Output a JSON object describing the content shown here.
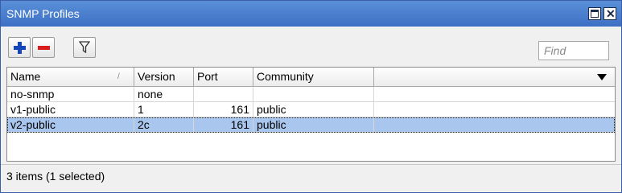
{
  "window": {
    "title": "SNMP Profiles",
    "maximize_icon": "maximize-icon",
    "close_icon": "close-icon",
    "close_glyph": "✕"
  },
  "toolbar": {
    "add_icon": "plus-icon",
    "remove_icon": "minus-icon",
    "filter_icon": "filter-icon",
    "find_placeholder": "Find"
  },
  "table": {
    "columns": [
      "Name",
      "Version",
      "Port",
      "Community"
    ],
    "sort_indicator": "/",
    "rows": [
      {
        "name": "no-snmp",
        "version": "none",
        "port": "",
        "community": ""
      },
      {
        "name": "v1-public",
        "version": "1",
        "port": "161",
        "community": "public"
      },
      {
        "name": "v2-public",
        "version": "2c",
        "port": "161",
        "community": "public"
      }
    ],
    "selected_row": 2
  },
  "status": {
    "text": "3 items (1 selected)"
  },
  "colors": {
    "titlebar": "#4a80d0",
    "selection": "#a9c6ee",
    "add": "#1545b8",
    "remove": "#d81e1e"
  }
}
